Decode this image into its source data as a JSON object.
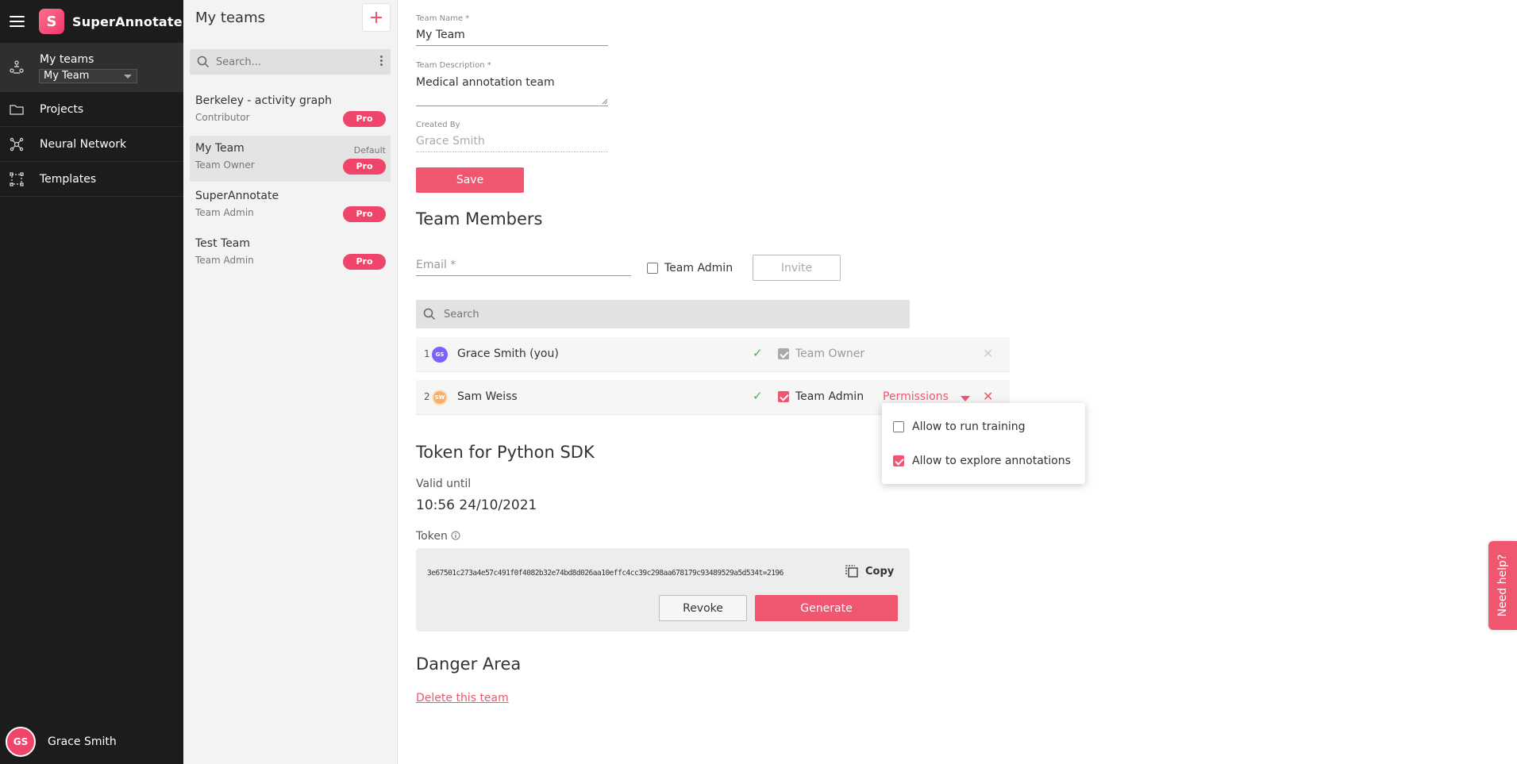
{
  "app": {
    "brand": "SuperAnnotate",
    "logo_letter": "S"
  },
  "nav": {
    "items": [
      {
        "label": "My teams",
        "icon": "teams-icon"
      },
      {
        "label": "Projects",
        "icon": "folder-icon"
      },
      {
        "label": "Neural Network",
        "icon": "network-icon"
      },
      {
        "label": "Templates",
        "icon": "templates-icon"
      }
    ],
    "team_select": "My Team",
    "user": {
      "initials": "GS",
      "name": "Grace Smith"
    }
  },
  "teams": {
    "title": "My teams",
    "search_placeholder": "Search...",
    "list": [
      {
        "name": "Berkeley - activity graph",
        "role": "Contributor",
        "badge": "Pro",
        "default": ""
      },
      {
        "name": "My Team",
        "role": "Team Owner",
        "badge": "Pro",
        "default": "Default"
      },
      {
        "name": "SuperAnnotate",
        "role": "Team Admin",
        "badge": "Pro",
        "default": ""
      },
      {
        "name": "Test Team",
        "role": "Team Admin",
        "badge": "Pro",
        "default": ""
      }
    ]
  },
  "form": {
    "team_name_label": "Team Name *",
    "team_name_value": "My Team",
    "team_desc_label": "Team Description *",
    "team_desc_value": "Medical annotation team",
    "created_by_label": "Created By",
    "created_by_value": "Grace Smith",
    "save_label": "Save"
  },
  "members": {
    "title": "Team Members",
    "email_placeholder": "Email *",
    "team_admin_label": "Team Admin",
    "invite_label": "Invite",
    "search_placeholder": "Search",
    "rows": [
      {
        "index": "1",
        "initials": "GS",
        "name": "Grace Smith (you)",
        "role": "Team Owner",
        "permissions": ""
      },
      {
        "index": "2",
        "initials": "SW",
        "name": "Sam Weiss",
        "role": "Team Admin",
        "permissions": "Permissions"
      }
    ],
    "popover": {
      "options": [
        {
          "label": "Allow to run training",
          "checked": false
        },
        {
          "label": "Allow to explore annotations",
          "checked": true
        }
      ]
    }
  },
  "token": {
    "title": "Token for Python SDK",
    "valid_label": "Valid until",
    "valid_value": "10:56 24/10/2021",
    "token_label": "Token",
    "token_value": "3e67501c273a4e57c491f0f4082b32e74bd8d026aa10effc4cc39c298aa678179c93489529a5d534t=2196",
    "copy_label": "Copy",
    "revoke_label": "Revoke",
    "generate_label": "Generate"
  },
  "danger": {
    "title": "Danger Area",
    "delete_label": "Delete this team"
  },
  "help": {
    "label": "Need help?"
  },
  "colors": {
    "accent": "#f0566f",
    "nav_bg": "#1c1c1c",
    "check_green": "#4caf50"
  }
}
